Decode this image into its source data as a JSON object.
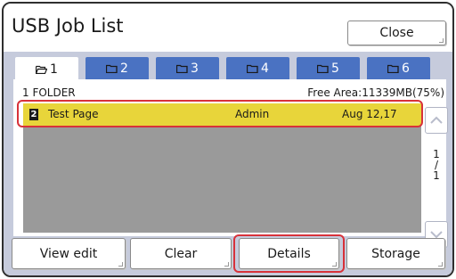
{
  "window": {
    "title": "USB Job List",
    "close_label": "Close"
  },
  "tabs": [
    {
      "label": "1",
      "icon": "folder-open-icon",
      "active": true
    },
    {
      "label": "2",
      "icon": "folder-icon",
      "active": false
    },
    {
      "label": "3",
      "icon": "folder-icon",
      "active": false
    },
    {
      "label": "4",
      "icon": "folder-icon",
      "active": false
    },
    {
      "label": "5",
      "icon": "folder-icon",
      "active": false
    },
    {
      "label": "6",
      "icon": "folder-icon",
      "active": false
    }
  ],
  "folder": {
    "label": "1 FOLDER",
    "free_area": "Free Area:11339MB(75%)"
  },
  "jobs": [
    {
      "num": "2",
      "name": "Test Page",
      "owner": "Admin",
      "date": "Aug 12,17",
      "selected": true
    }
  ],
  "pager": {
    "current": "1",
    "sep": "/",
    "total": "1"
  },
  "footer": {
    "view_edit_label": "View edit",
    "clear_label": "Clear",
    "details_label": "Details",
    "storage_label": "Storage"
  },
  "colors": {
    "tab_blue": "#4a72c2",
    "panel_bg": "#c6cbdc",
    "selected_row": "#e8d53a",
    "highlight_red": "#d8323a"
  }
}
